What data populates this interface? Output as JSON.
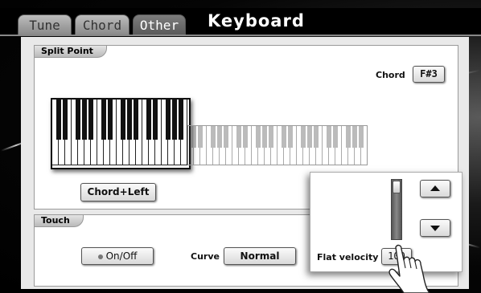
{
  "tabs": [
    {
      "label": "Tune",
      "active": false
    },
    {
      "label": "Chord",
      "active": false
    },
    {
      "label": "Other",
      "active": true
    }
  ],
  "title": "Keyboard",
  "split_point": {
    "section_label": "Split Point",
    "chord_label": "Chord",
    "chord_value": "F#3",
    "mode_button": "Chord+Left"
  },
  "touch": {
    "section_label": "Touch",
    "toggle_label": "On/Off",
    "curve_label": "Curve",
    "curve_value": "Normal"
  },
  "popup": {
    "flat_velocity_label": "Flat velocity",
    "flat_velocity_value": "100",
    "up_icon": "up-arrow-icon",
    "down_icon": "down-arrow-icon"
  },
  "colors": {
    "background": "#000000",
    "panel": "#e9e9e9",
    "active_tab": "#666666"
  }
}
